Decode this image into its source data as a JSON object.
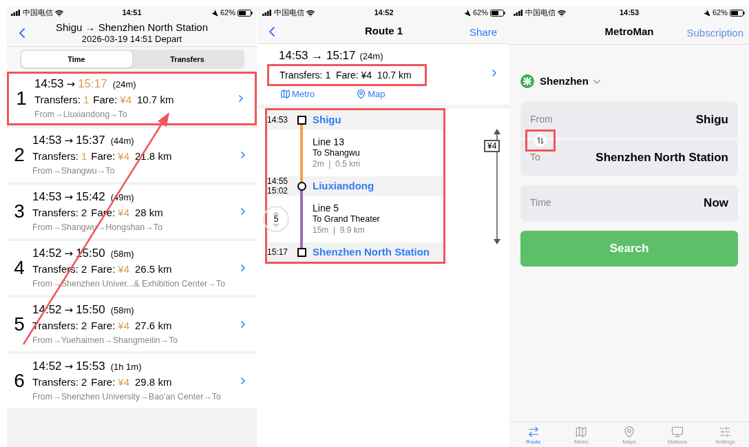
{
  "route_list": {
    "status_bar": {
      "carrier": "中国电信",
      "time": "14:51",
      "battery": "62%"
    },
    "header": {
      "title": "Shigu → Shenzhen North Station",
      "subtitle": "2026-03-19 14:51 Depart"
    },
    "sort_tabs": [
      {
        "label": "Time",
        "selected": true
      },
      {
        "label": "Transfers",
        "selected": false
      }
    ],
    "routes": [
      {
        "index": "1",
        "depart": "14:53",
        "arrow": "→",
        "arrive": "15:17",
        "arrive_accent": true,
        "duration": "(24m)",
        "transfers_label": "Transfers:",
        "transfers": "1",
        "transfers_accent": true,
        "fare_label": "Fare:",
        "fare": "¥4",
        "distance": "10.7 km",
        "via": "From→Liuxiandong→To",
        "highlighted": true
      },
      {
        "index": "2",
        "depart": "14:53",
        "arrow": "→",
        "arrive": "15:37",
        "arrive_accent": false,
        "duration": "(44m)",
        "transfers_label": "Transfers:",
        "transfers": "1",
        "transfers_accent": true,
        "fare_label": "Fare:",
        "fare": "¥4",
        "distance": "21.8 km",
        "via": "From→Shangwu→To",
        "highlighted": false
      },
      {
        "index": "3",
        "depart": "14:53",
        "arrow": "→",
        "arrive": "15:42",
        "arrive_accent": false,
        "duration": "(49m)",
        "transfers_label": "Transfers:",
        "transfers": "2",
        "transfers_accent": false,
        "fare_label": "Fare:",
        "fare": "¥4",
        "distance": "28 km",
        "via": "From→Shangwu→Hongshan→To",
        "highlighted": false
      },
      {
        "index": "4",
        "depart": "14:52",
        "arrow": "→",
        "arrive": "15:50",
        "arrive_accent": false,
        "duration": "(58m)",
        "transfers_label": "Transfers:",
        "transfers": "2",
        "transfers_accent": false,
        "fare_label": "Fare:",
        "fare": "¥4",
        "distance": "26.5 km",
        "via": "From→Shenzhen Univer...& Exhibition Center→To",
        "highlighted": false
      },
      {
        "index": "5",
        "depart": "14:52",
        "arrow": "→",
        "arrive": "15:50",
        "arrive_accent": false,
        "duration": "(58m)",
        "transfers_label": "Transfers:",
        "transfers": "2",
        "transfers_accent": false,
        "fare_label": "Fare:",
        "fare": "¥4",
        "distance": "27.6 km",
        "via": "From→Yuehaimen→Shangmeilin→To",
        "highlighted": false
      },
      {
        "index": "6",
        "depart": "14:52",
        "arrow": "→",
        "arrive": "15:53",
        "arrive_accent": false,
        "duration": "(1h 1m)",
        "transfers_label": "Transfers:",
        "transfers": "2",
        "transfers_accent": false,
        "fare_label": "Fare:",
        "fare": "¥4",
        "distance": "29.8 km",
        "via": "From→Shenzhen University→Bao'an Center→To",
        "highlighted": false
      }
    ]
  },
  "route_detail": {
    "status_bar": {
      "carrier": "中国电信",
      "time": "14:52",
      "battery": "62%"
    },
    "nav": {
      "title": "Route 1",
      "action": "Share"
    },
    "summary": {
      "times": "14:53 → 15:17",
      "duration": "(24m)",
      "info": "Transfers: 1  Fare: ¥4  10.7 km",
      "highlighted": true
    },
    "links": [
      {
        "kind": "metro",
        "label": "Metro"
      },
      {
        "kind": "map",
        "label": "Map"
      }
    ],
    "timeline": {
      "highlighted": true,
      "fare": "¥4",
      "items": [
        {
          "kind": "terminal",
          "times": [
            "14:53"
          ],
          "name": "Shigu"
        },
        {
          "kind": "segment",
          "line": "Line 13",
          "direction": "To Shangwu",
          "info": "2m  |  0.5 km",
          "color": "#f0a04b"
        },
        {
          "kind": "transfer",
          "times": [
            "14:55",
            "15:02"
          ],
          "name": "Liuxiandong"
        },
        {
          "kind": "segment",
          "line": "Line 5",
          "direction": "To Grand Theater",
          "info": "15m  |  9.9 km",
          "color": "#9b6bbb",
          "stop_count": "5"
        },
        {
          "kind": "terminal",
          "times": [
            "15:17"
          ],
          "name": "Shenzhen North Station"
        }
      ]
    }
  },
  "search": {
    "status_bar": {
      "carrier": "中国电信",
      "time": "14:53",
      "battery": "62%"
    },
    "nav": {
      "title": "MetroMan",
      "action": "Subscription"
    },
    "city": "Shenzhen",
    "from": {
      "label": "From",
      "value": "Shigu"
    },
    "to": {
      "label": "To",
      "value": "Shenzhen North Station"
    },
    "swap_highlighted": true,
    "time": {
      "label": "Time",
      "value": "Now"
    },
    "search_button": "Search",
    "tabs": [
      {
        "kind": "route",
        "label": "Route",
        "selected": true
      },
      {
        "kind": "metro",
        "label": "Metro",
        "selected": false
      },
      {
        "kind": "maps",
        "label": "Maps",
        "selected": false
      },
      {
        "kind": "stations",
        "label": "Stations",
        "selected": false
      },
      {
        "kind": "settings",
        "label": "Settings",
        "selected": false
      }
    ]
  }
}
